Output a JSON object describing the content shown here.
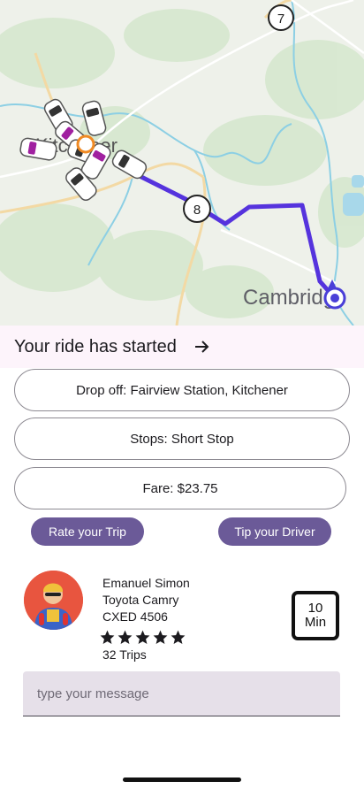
{
  "map": {
    "city_start_label": "Kitchener",
    "city_end_label": "Cambridge",
    "highway_labels": [
      "7",
      "8"
    ]
  },
  "ride": {
    "title": "Your ride has started"
  },
  "trip": {
    "dropoff": "Drop off: Fairview Station, Kitchener",
    "stops": "Stops: Short Stop",
    "fare": "Fare: $23.75"
  },
  "actions": {
    "rate_label": "Rate your Trip",
    "tip_label": "Tip your Driver"
  },
  "driver": {
    "name": "Emanuel Simon",
    "car": "Toyota Camry",
    "plate": "CXED 4506",
    "rating_stars": 5,
    "trips": "32 Trips"
  },
  "eta": {
    "value": "10",
    "unit": "Min"
  },
  "message": {
    "placeholder": "type your message"
  },
  "colors": {
    "accent": "#6b5a98",
    "route": "#5533dd",
    "banner": "#fdf4fb"
  }
}
